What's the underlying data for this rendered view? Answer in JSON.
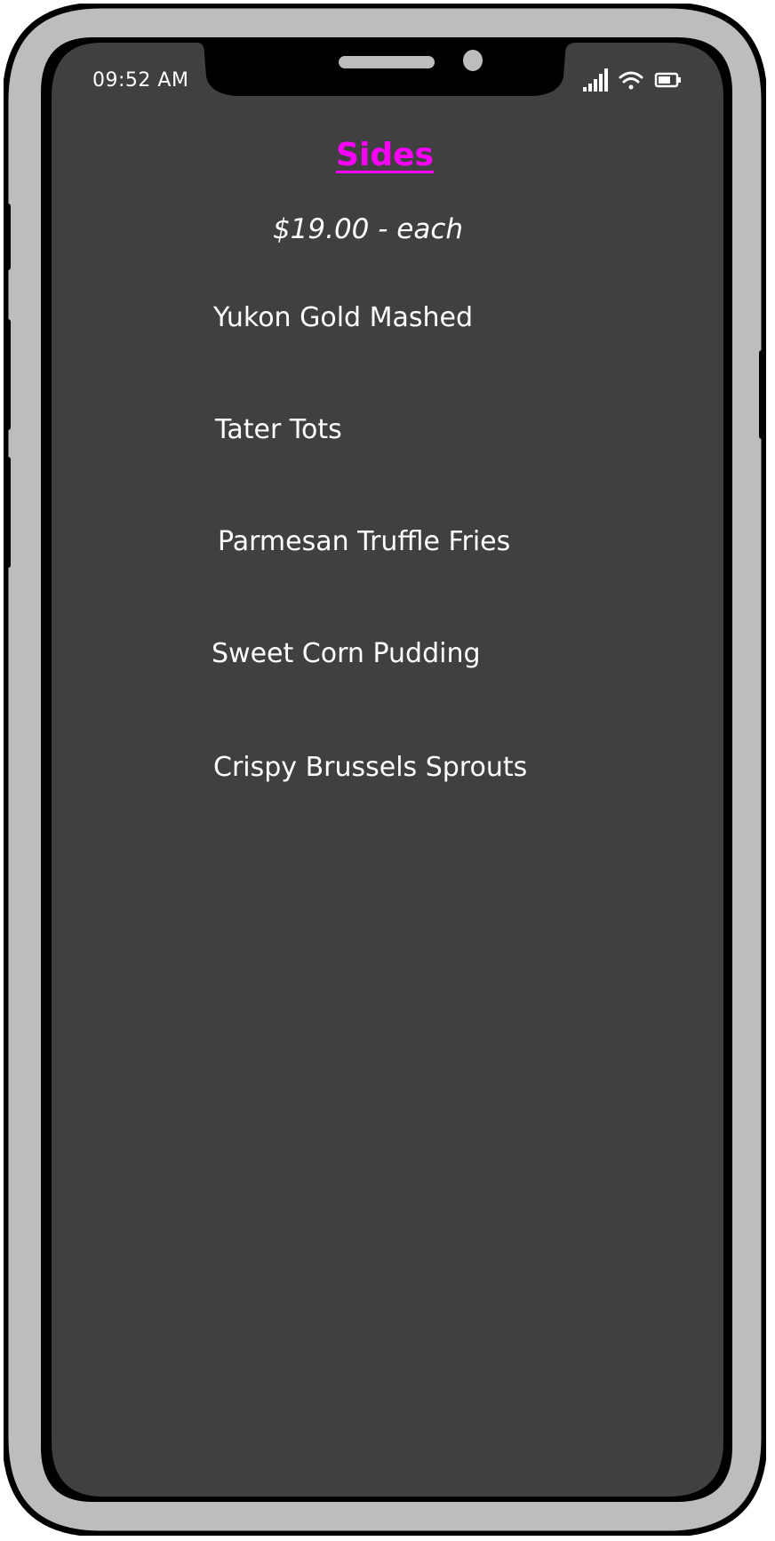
{
  "status_bar": {
    "time": "09:52 AM",
    "icons": [
      "signal-icon",
      "wifi-icon",
      "battery-icon"
    ]
  },
  "menu": {
    "title": "Sides",
    "price": "$19.00 - each",
    "items": [
      {
        "label": "Yukon Gold Mashed"
      },
      {
        "label": "Tater Tots"
      },
      {
        "label": "Parmesan Truffle Fries"
      },
      {
        "label": "Sweet Corn Pudding"
      },
      {
        "label": "Crispy Brussels Sprouts"
      }
    ]
  },
  "colors": {
    "screen_background": "#404040",
    "frame_outer": "#bdbdbd",
    "title_accent": "#ff00ff",
    "text": "#ffffff"
  }
}
